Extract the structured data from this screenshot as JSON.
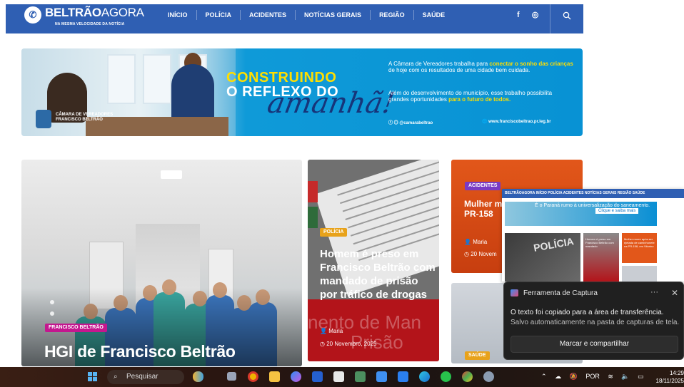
{
  "site": {
    "logo_main": "BELTRÃO",
    "logo_sub": "AGORA",
    "tagline": "NA MESMA VELOCIDADE DA NOTÍCIA",
    "nav": [
      "INÍCIO",
      "POLÍCIA",
      "ACIDENTES",
      "NOTÍCIAS GERAIS",
      "REGIÃO",
      "SAÚDE"
    ],
    "social_facebook": "f",
    "social_instagram": "◎",
    "search_icon": "magnifier"
  },
  "banner": {
    "headline_1": "CONSTRUINDO",
    "headline_2": "O REFLEXO DO",
    "script": "amanhã!",
    "chamber_1": "CÂMARA DE VEREADORES",
    "chamber_2": "FRANCISCO BELTRÃO",
    "para1_a": "A Câmara de Vereadores  trabalha para ",
    "para1_hl": "conectar o sonho das crianças",
    "para1_b": " de hoje com os resultados de uma cidade bem cuidada.",
    "para2_a": "Além do desenvolvimento do município, esse trabalho possibilita grandes oportunidades ",
    "para2_hl": "para o futuro de todos.",
    "handle": "@camarabeltrao",
    "website": "www.franciscobeltrao.pr.leg.br"
  },
  "cards": {
    "main": {
      "tag": "FRANCISCO BELTRÃO",
      "title": "HGI de Francisco Beltrão"
    },
    "mid": {
      "tag": "POLÍCIA",
      "title": "Homem é preso em Francisco Beltrão com mandado de prisão por tráfico de drogas",
      "ghost_1": "nento de Man",
      "ghost_2": "Prisão",
      "author": "Maria",
      "date": "20 Novembro, 2025"
    },
    "right": {
      "tag": "ACIDENTES",
      "title": "Mulher morre ejetada em na PR-158",
      "author": "Maria",
      "date": "20 Novem"
    },
    "right2": {
      "tag": "SAÚDE"
    }
  },
  "thumb": {
    "bar_text": "BELTRÃOAGORA   INÍCIO   POLÍCIA   ACIDENTES   NOTÍCIAS GERAIS   REGIÃO   SAÚDE",
    "ad_text": "É o Paraná rumo à universalização do saneamento.",
    "ad_button": "Clique e saiba mais",
    "img1_text": "POLÍCIA",
    "img2_text": "Homem é preso em Francisco Beltrão com mandado",
    "img3_text": "Mulher morre após ser ejetada de caminhonete na PR-158, em Vitorino"
  },
  "toast": {
    "app_name": "Ferramenta de Captura",
    "more": "···",
    "close": "✕",
    "line1": "O texto foi copiado para a área de transferência.",
    "line2": "Salvo automaticamente na pasta de capturas de tela.",
    "action": "Marcar e compartilhar"
  },
  "taskbar": {
    "search_placeholder": "Pesquisar",
    "language": "POR",
    "time": "14:29",
    "date": "18/11/2025"
  }
}
